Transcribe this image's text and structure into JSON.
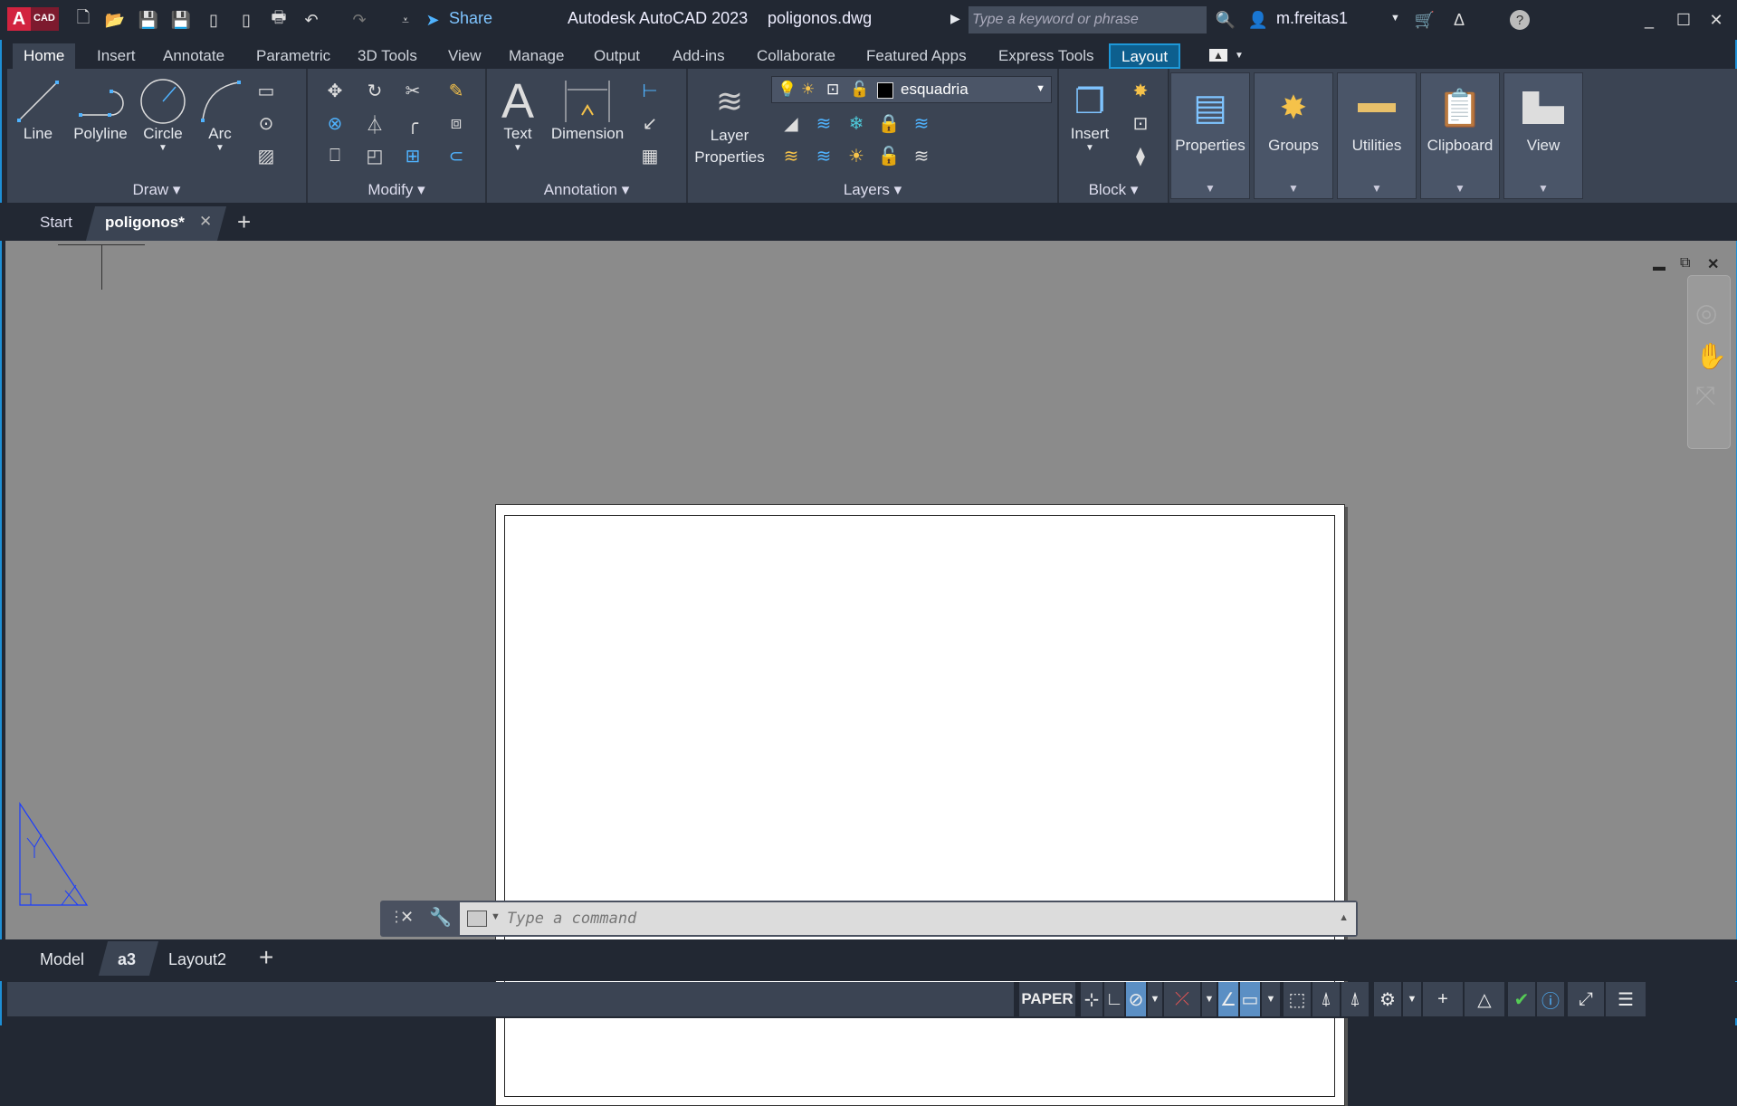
{
  "app": {
    "logo": "A CAD",
    "title": "Autodesk AutoCAD 2023",
    "file": "poligonos.dwg",
    "share": "Share",
    "search_placeholder": "Type a keyword or phrase",
    "user": "m.freitas1"
  },
  "ribbon_tabs": [
    "Home",
    "Insert",
    "Annotate",
    "Parametric",
    "3D Tools",
    "View",
    "Manage",
    "Output",
    "Add-ins",
    "Collaborate",
    "Featured Apps",
    "Express Tools",
    "Layout"
  ],
  "panels": {
    "draw": {
      "label": "Draw",
      "line": "Line",
      "polyline": "Polyline",
      "circle": "Circle",
      "arc": "Arc"
    },
    "modify": {
      "label": "Modify"
    },
    "annotation": {
      "label": "Annotation",
      "text": "Text",
      "dimension": "Dimension"
    },
    "layers": {
      "label": "Layers",
      "layer_properties_1": "Layer",
      "layer_properties_2": "Properties",
      "current_layer": "esquadria",
      "current_color": "#000000"
    },
    "block": {
      "label": "Block",
      "insert": "Insert"
    },
    "collapsed": [
      "Properties",
      "Groups",
      "Utilities",
      "Clipboard",
      "View"
    ]
  },
  "file_tabs": {
    "start": "Start",
    "active": "poligonos*"
  },
  "command": {
    "placeholder": "Type a command"
  },
  "layout_tabs": [
    "Model",
    "a3",
    "Layout2"
  ],
  "status": {
    "space": "PAPER"
  },
  "colors": {
    "accent": "#1d8fd6",
    "ribbon": "#3b4453",
    "canvas": "#8b8b8b",
    "drawing_lines": "#1a3cff"
  }
}
